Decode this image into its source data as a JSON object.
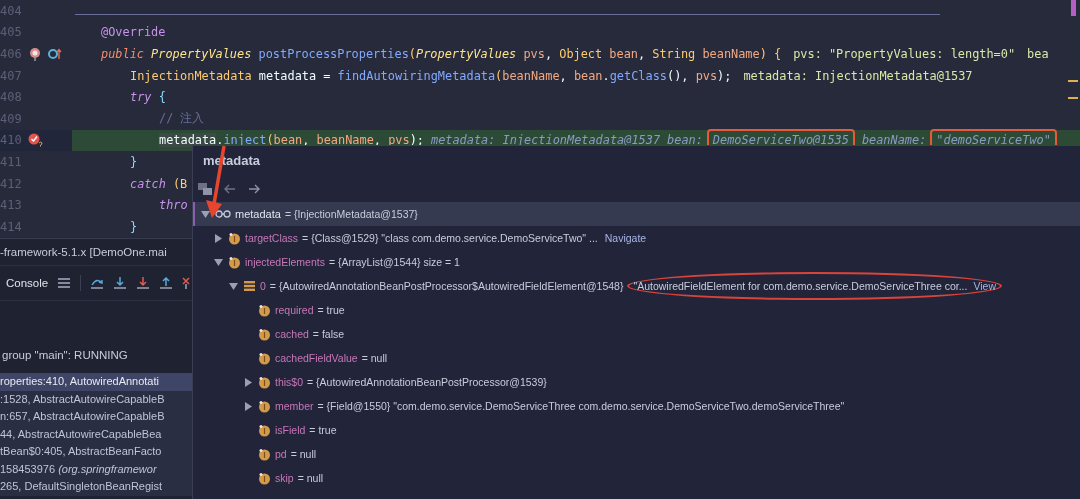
{
  "editor": {
    "lines": [
      {
        "number": "404",
        "current": false
      },
      {
        "number": "405",
        "current": false,
        "tokens": [
          {
            "text": "@Override",
            "kind": "annotation"
          }
        ]
      },
      {
        "number": "406",
        "current": false,
        "gutter": [
          {
            "kind": "debug-target"
          },
          {
            "kind": "override"
          }
        ],
        "tokens": [
          {
            "text": "public",
            "kind": "modifier"
          },
          {
            "text": " PropertyValues",
            "kind": "type"
          },
          {
            "text": " postProcessProperties",
            "kind": "method"
          },
          {
            "text": "(",
            "kind": "punct"
          },
          {
            "text": "PropertyValues",
            "kind": "type"
          },
          {
            "text": " pvs",
            "kind": "param"
          },
          {
            "text": ", ",
            "kind": "plain"
          },
          {
            "text": "Object",
            "kind": "type-plain"
          },
          {
            "text": " bean",
            "kind": "param"
          },
          {
            "text": ", ",
            "kind": "plain"
          },
          {
            "text": "String",
            "kind": "type-plain"
          },
          {
            "text": " beanName",
            "kind": "param"
          },
          {
            "text": ") {",
            "kind": "punct"
          },
          {
            "text": "pvs: \"PropertyValues: length=0\"",
            "kind": "hint"
          },
          {
            "text": "bea",
            "kind": "hint"
          }
        ],
        "children": [
          {
            "number": "407",
            "current": false,
            "tokens": [
              {
                "text": "InjectionMetadata",
                "kind": "type-plain"
              },
              {
                "text": " metadata = ",
                "kind": "plain"
              },
              {
                "text": "findAutowiringMetadata",
                "kind": "method"
              },
              {
                "text": "(",
                "kind": "punct"
              },
              {
                "text": "beanName",
                "kind": "param"
              },
              {
                "text": ", ",
                "kind": "plain"
              },
              {
                "text": "bean",
                "kind": "param"
              },
              {
                "text": ".",
                "kind": "plain"
              },
              {
                "text": "getClass",
                "kind": "method"
              },
              {
                "text": "(), ",
                "kind": "plain"
              },
              {
                "text": "pvs",
                "kind": "param"
              },
              {
                "text": ");",
                "kind": "plain"
              },
              {
                "text": "metadata: InjectionMetadata@1537",
                "kind": "hint"
              }
            ]
          },
          {
            "number": "408",
            "current": false,
            "tokens": [
              {
                "text": "try",
                "kind": "keyword"
              },
              {
                "text": " {",
                "kind": "brace"
              }
            ],
            "children": [
              {
                "number": "409",
                "current": false,
                "tokens": [
                  {
                    "text": "// 注入",
                    "kind": "comment"
                  }
                ]
              },
              {
                "number": "410",
                "current": true,
                "gutter": [
                  {
                    "kind": "breakpoint"
                  }
                ],
                "tokens": [
                  {
                    "text": "metadata",
                    "kind": "hover"
                  },
                  {
                    "text": ".",
                    "kind": "plain"
                  },
                  {
                    "text": "inject",
                    "kind": "method"
                  },
                  {
                    "text": "(",
                    "kind": "punct"
                  },
                  {
                    "text": "bean",
                    "kind": "param"
                  },
                  {
                    "text": ", ",
                    "kind": "plain"
                  },
                  {
                    "text": "beanName",
                    "kind": "param"
                  },
                  {
                    "text": ", ",
                    "kind": "plain"
                  },
                  {
                    "text": "pvs",
                    "kind": "param"
                  },
                  {
                    "text": ");",
                    "kind": "plain"
                  },
                  {
                    "text": "metadata: InjectionMetadata@1537",
                    "kind": "hint-italic"
                  },
                  {
                    "text": "bean:",
                    "kind": "hint-italic"
                  },
                  {
                    "text": "DemoServiceTwo@1535",
                    "kind": "hint-boxed"
                  },
                  {
                    "text": "beanName:",
                    "kind": "hint-italic"
                  },
                  {
                    "text": "\"demoServiceTwo\"",
                    "kind": "hint-boxed"
                  }
                ]
              }
            ]
          },
          {
            "number": "411",
            "current": false,
            "tokens": [
              {
                "text": "}",
                "kind": "brace"
              }
            ]
          },
          {
            "number": "412",
            "current": false,
            "tokens": [
              {
                "text": "catch",
                "kind": "keyword"
              },
              {
                "text": " (B",
                "kind": "punct"
              }
            ],
            "children": [
              {
                "number": "413",
                "current": false,
                "tokens": [
                  {
                    "text": "thro",
                    "kind": "keyword"
                  }
                ]
              }
            ]
          },
          {
            "number": "414",
            "current": false,
            "tokens": [
              {
                "text": "}",
                "kind": "brace"
              }
            ]
          }
        ]
      }
    ]
  },
  "debug_panel": {
    "session": "-framework-5.1.x [DemoOne.mai",
    "tabs": [
      {
        "label": "Console",
        "selected": false
      }
    ],
    "tools": [
      {
        "kind": "frames"
      },
      {
        "kind": "step-over"
      },
      {
        "kind": "step-into"
      },
      {
        "kind": "force-step-into"
      },
      {
        "kind": "step-out"
      },
      {
        "kind": "stop"
      }
    ],
    "thread": "group \"main\": RUNNING",
    "frames": [
      {
        "text": "roperties:410, AutowiredAnnotati",
        "selected": true
      },
      {
        "text": ":1528, AbstractAutowireCapableB",
        "selected": false
      },
      {
        "text": "n:657, AbstractAutowireCapableB",
        "selected": false
      },
      {
        "text": "44, AbstractAutowireCapableBea",
        "selected": false
      },
      {
        "text": "tBean$0:405, AbstractBeanFacto",
        "selected": false
      },
      {
        "text": "158453976 *(org.springframewor*",
        "selected": false
      },
      {
        "text": "265, DefaultSingletonBeanRegist",
        "selected": false
      }
    ]
  },
  "popup": {
    "title": "metadata",
    "nodes": [
      {
        "kind": "watch",
        "name": "metadata",
        "value": "= {InjectionMetadata@1537}",
        "expanded": true,
        "selected": true,
        "children": [
          {
            "kind": "field",
            "name": "targetClass",
            "value": "= {Class@1529} \"class com.demo.service.DemoServiceTwo\" ...",
            "link": "Navigate",
            "expanded": false,
            "selected": false
          },
          {
            "kind": "field",
            "name": "injectedElements",
            "value": "= {ArrayList@1544}  size = 1",
            "expanded": true,
            "selected": false,
            "children": [
              {
                "kind": "list",
                "name": "0",
                "value": "= {AutowiredAnnotationBeanPostProcessor$AutowiredFieldElement@1548}",
                "note": "\"AutowiredFieldElement for com.demo.service.DemoServiceThree cor...",
                "link": "View",
                "circled": true,
                "expanded": true,
                "selected": false,
                "children": [
                  {
                    "kind": "field",
                    "name": "required",
                    "value": "= true",
                    "selected": false
                  },
                  {
                    "kind": "field",
                    "name": "cached",
                    "value": "= false",
                    "selected": false
                  },
                  {
                    "kind": "field",
                    "name": "cachedFieldValue",
                    "value": "= null",
                    "selected": false
                  },
                  {
                    "kind": "field",
                    "name": "this$0",
                    "value": "= {AutowiredAnnotationBeanPostProcessor@1539}",
                    "expanded": false,
                    "selected": false
                  },
                  {
                    "kind": "field",
                    "name": "member",
                    "value": "= {Field@1550} \"com.demo.service.DemoServiceThree com.demo.service.DemoServiceTwo.demoServiceThree\"",
                    "expanded": false,
                    "selected": false
                  },
                  {
                    "kind": "field",
                    "name": "isField",
                    "value": "= true",
                    "selected": false
                  },
                  {
                    "kind": "field",
                    "name": "pd",
                    "value": "= null",
                    "selected": false
                  },
                  {
                    "kind": "field",
                    "name": "skip",
                    "value": "= null",
                    "selected": false
                  }
                ]
              }
            ]
          }
        ]
      }
    ]
  },
  "annotations": [
    {
      "kind": "arrow"
    }
  ]
}
